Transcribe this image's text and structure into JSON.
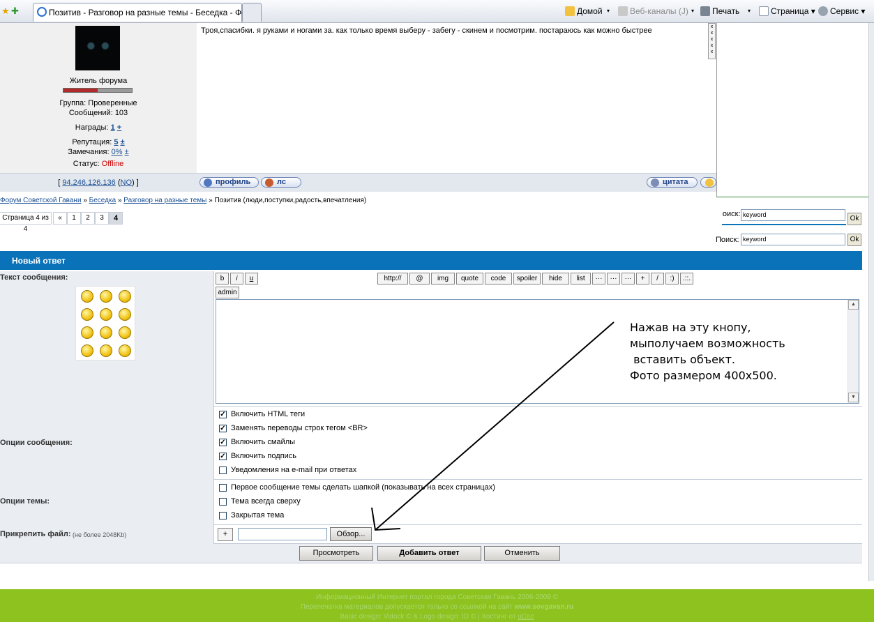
{
  "browser": {
    "active_tab_title": "Позитив - Разговор на разные темы - Беседка - Фо...",
    "home_label": "Домой",
    "feeds_label": "Веб-каналы (J)",
    "print_label": "Печать",
    "page_label": "Страница",
    "tools_label": "Сервис"
  },
  "post": {
    "text": "Троя,спасибки. я руками и ногами за. как только время выберу - забегу - скинем и посмотрим. постараюсь как можно быстрее",
    "author_rank": "Житель форума",
    "rank_level": 0.5,
    "group": "Группа: Проверенные",
    "messages": "Сообщений: 103",
    "awards_label": "Награды:",
    "awards_value": "1",
    "reputation_label": "Репутация:",
    "reputation_value": "5",
    "warnings_label": "Замечания:",
    "warnings_value": "0%",
    "plus": "±",
    "plus_simple": "+",
    "status_label": "Статус:",
    "status_value": "Offline",
    "ip_open": "[",
    "ip": "94.246.126.136",
    "ip_country_open": "(",
    "ip_country": "NO",
    "ip_close": ") ]",
    "profile_button": "профиль",
    "pm_button": "лс",
    "quote_button": "цитата"
  },
  "breadcrumb": {
    "items": [
      "Форум Советской Гавани",
      "Беседка",
      "Разговор на разные темы"
    ],
    "separator": "»",
    "current": "Позитив (люди,поступки,радость,впечатления)"
  },
  "pager": {
    "label": "Страница 4 из 4",
    "prev": "«",
    "pages": [
      "1",
      "2",
      "3"
    ],
    "current": "4"
  },
  "search": {
    "label": "Поиск:",
    "value": "keyword",
    "ok": "Ok"
  },
  "form": {
    "title": "Новый ответ",
    "message_label": "Текст сообщения:",
    "bbcode": [
      "b",
      "i",
      "u",
      "http://",
      "@",
      "img",
      "quote",
      "code",
      "spoiler",
      "hide",
      "list",
      "···",
      "···",
      "···",
      "+",
      "/",
      ":)",
      ".::."
    ],
    "admin_button": "admin",
    "message_options_label": "Опции сообщения:",
    "message_options": [
      {
        "label": "Включить HTML теги",
        "checked": true
      },
      {
        "label": "Заменять переводы строк тегом <BR>",
        "checked": true
      },
      {
        "label": "Включить смайлы",
        "checked": true
      },
      {
        "label": "Включить подпись",
        "checked": true
      },
      {
        "label": "Уведомления на e-mail при ответах",
        "checked": false
      }
    ],
    "topic_options_label": "Опции темы:",
    "topic_options": [
      {
        "label": "Первое сообщение темы сделать шапкой (показывать на всех страницах)",
        "checked": false
      },
      {
        "label": "Тема всегда сверху",
        "checked": false
      },
      {
        "label": "Закрытая тема",
        "checked": false
      }
    ],
    "attach_label": "Прикрепить файл:",
    "attach_hint": "(не более 2048Kb)",
    "attach_add": "+",
    "browse_button": "Обзор...",
    "preview_button": "Просмотреть",
    "submit_button": "Добавить ответ",
    "cancel_button": "Отменить"
  },
  "annotation": {
    "text": "Нажав на эту кнопу,\nмыполучаем возможность\n вставить объект.\nФото размером 400x500."
  },
  "footer": {
    "line1": "Информационный Интернет портал города Советская Гавань 2006-2009 ©",
    "line2_prefix": "Перепечатка материалов допускается только со ссылкой на сайт",
    "line2_site": "www.sovgavan.ru",
    "line3_prefix": "Basic design: Vidock © & Logo design: ID © | Хостинг от",
    "line3_host": "uCoz"
  },
  "colors": {
    "header_blue": "#0a72b8",
    "footer_green": "#8dc21f",
    "offline_red": "#cc0000",
    "link_blue": "#1a4f93"
  }
}
